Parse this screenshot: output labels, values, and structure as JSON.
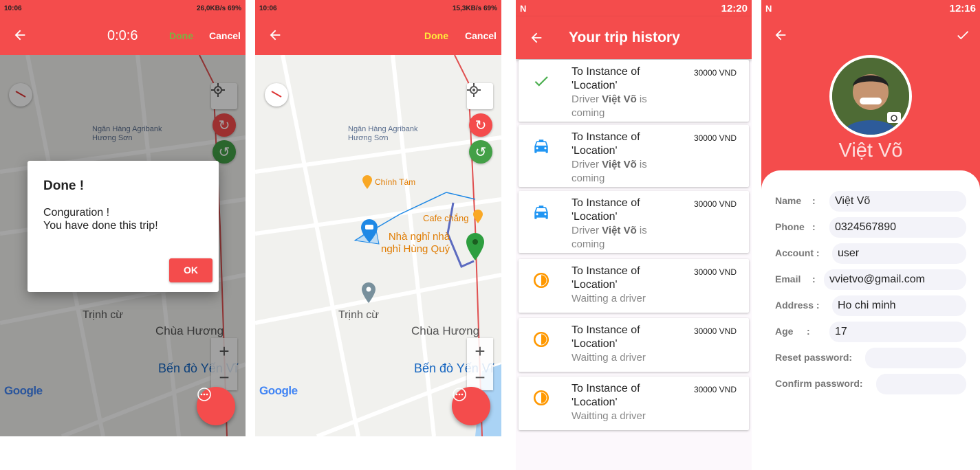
{
  "screen1": {
    "status_time": "10:06",
    "status_right": "26,0KB/s  69%",
    "timer": "0:0:6",
    "done_label": "Done",
    "cancel_label": "Cancel",
    "dialog": {
      "title": "Done !",
      "line1": "Conguration !",
      "line2": "You have done this trip!",
      "ok_label": "OK"
    },
    "map_labels": {
      "bank": "Ngân Hàng Agribank\nHương Sơn",
      "trinh_cu": "Trịnh cừ",
      "chua_huong": "Chùa Hương",
      "ben_do": "Bến đò Yến Vĩ",
      "google": "Google"
    }
  },
  "screen2": {
    "status_time": "10:06",
    "status_right": "15,3KB/s  69%",
    "done_label": "Done",
    "cancel_label": "Cancel",
    "map_labels": {
      "bank": "Ngân Hàng Agribank\nHương Sơn",
      "chinh_tam": "Chính Tám",
      "cafe": "Cafe chắng",
      "nha_nghi": "Nhà nghỉ nhà\nnghỉ Hùng Quý",
      "trinh_cu": "Trịnh cừ",
      "chua_huong": "Chùa Hương",
      "ben_do": "Bến đò Yến Vĩ",
      "google": "Google"
    }
  },
  "screen3": {
    "status_time": "12:20",
    "title": "Your trip history",
    "trips": [
      {
        "icon": "check-icon",
        "title": "To Instance of 'Location'",
        "sub_prefix": "Driver ",
        "driver": "Việt Võ",
        "sub_suffix": " is coming",
        "price": "30000 VND"
      },
      {
        "icon": "taxi-icon",
        "title": "To Instance of 'Location'",
        "sub_prefix": "Driver ",
        "driver": "Việt Võ",
        "sub_suffix": " is coming",
        "price": "30000 VND"
      },
      {
        "icon": "taxi-icon",
        "title": "To Instance of 'Location'",
        "sub_prefix": "Driver ",
        "driver": "Việt Võ",
        "sub_suffix": " is coming",
        "price": "30000 VND"
      },
      {
        "icon": "waiting-icon",
        "title": "To Instance of 'Location'",
        "sub_text": "Waitting a driver",
        "price": "30000 VND"
      },
      {
        "icon": "waiting-icon",
        "title": "To Instance of 'Location'",
        "sub_text": "Waitting a driver",
        "price": "30000 VND"
      },
      {
        "icon": "waiting-icon",
        "title": "To Instance of 'Location'",
        "sub_text": "Waitting a driver",
        "price": "30000 VND"
      }
    ]
  },
  "screen4": {
    "status_time": "12:16",
    "name": "Việt Võ",
    "fields": [
      {
        "label": "Name",
        "sep": ":",
        "value": "Việt Võ"
      },
      {
        "label": "Phone",
        "sep": ":",
        "value": "0324567890"
      },
      {
        "label": "Account :",
        "sep": "",
        "value": "user"
      },
      {
        "label": "Email",
        "sep": ":",
        "value": "vvietvo@gmail.com"
      },
      {
        "label": "Address :",
        "sep": "",
        "value": "Ho chi minh"
      },
      {
        "label": "Age",
        "sep": ":",
        "value": "17"
      },
      {
        "label": "Reset password:",
        "sep": "",
        "value": ""
      },
      {
        "label": "Confirm password:",
        "sep": "",
        "value": ""
      }
    ]
  },
  "colors": {
    "primary_red": "#f44c4c",
    "done_green": "#7cb342",
    "done_yellow": "#ffeb3b",
    "taxi_blue": "#2196f3",
    "waiting_orange": "#ff9800",
    "check_green": "#4caf50"
  }
}
